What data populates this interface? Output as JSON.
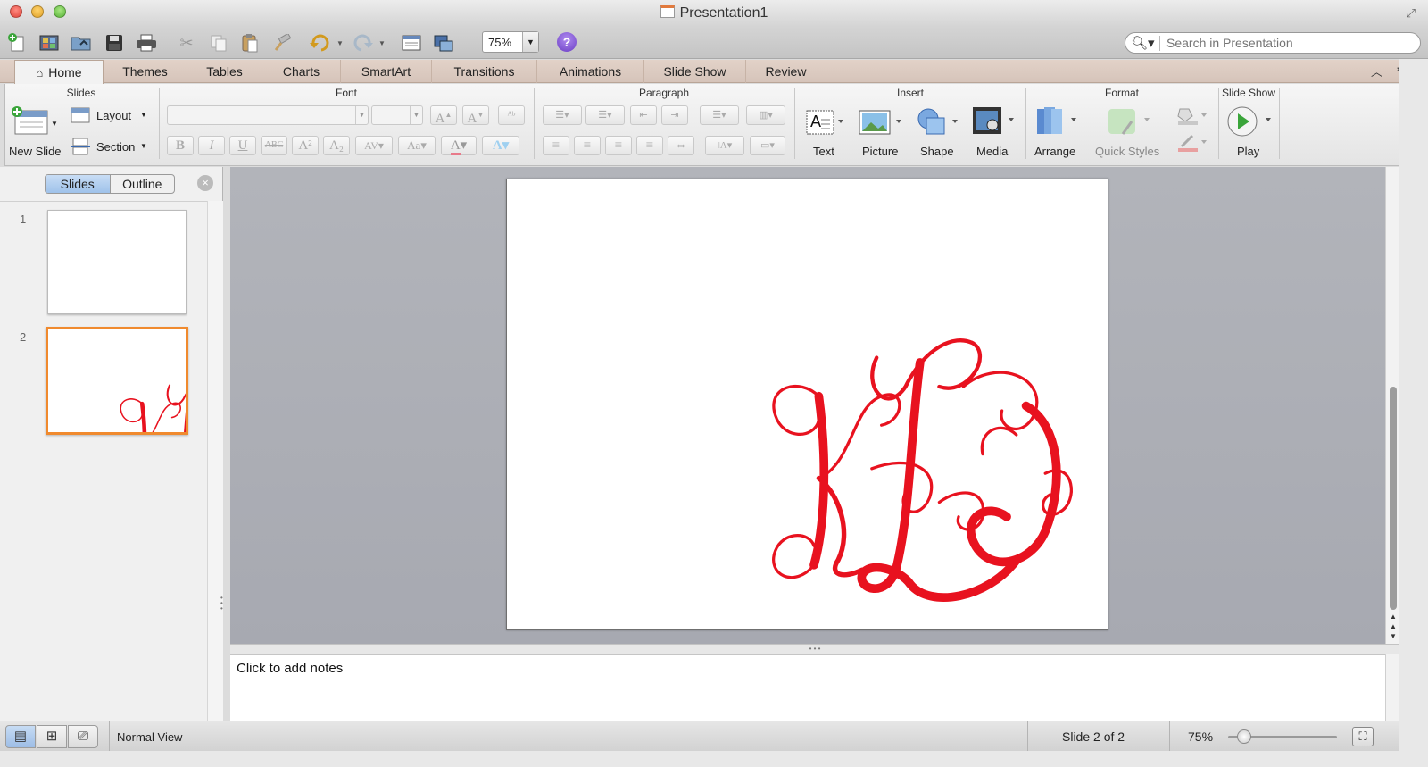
{
  "window": {
    "title": "Presentation1"
  },
  "toolbar": {
    "zoom_value": "75%",
    "help_label": "?",
    "search_placeholder": "Search in Presentation",
    "icons": [
      "new-document-icon",
      "gallery-icon",
      "open-icon",
      "save-icon",
      "print-icon",
      "cut-icon",
      "copy-icon",
      "paste-icon",
      "format-painter-icon",
      "undo-icon",
      "redo-icon",
      "slide-layout-icon",
      "media-browser-icon",
      "help-icon",
      "search-icon"
    ]
  },
  "tabs": [
    {
      "label": "Home",
      "active": true
    },
    {
      "label": "Themes"
    },
    {
      "label": "Tables"
    },
    {
      "label": "Charts"
    },
    {
      "label": "SmartArt"
    },
    {
      "label": "Transitions"
    },
    {
      "label": "Animations"
    },
    {
      "label": "Slide Show"
    },
    {
      "label": "Review"
    }
  ],
  "ribbon": {
    "groups": {
      "slides": "Slides",
      "font": "Font",
      "paragraph": "Paragraph",
      "insert": "Insert",
      "format": "Format",
      "slideshow": "Slide Show"
    },
    "new_slide": "New Slide",
    "layout": "Layout",
    "section": "Section",
    "text": "Text",
    "picture": "Picture",
    "shape": "Shape",
    "media": "Media",
    "arrange": "Arrange",
    "quick_styles": "Quick Styles",
    "play": "Play",
    "font_buttons": {
      "bold": "B",
      "italic": "I",
      "underline": "U",
      "strike": "ABC",
      "superscript": "A²",
      "subscript": "A₂"
    }
  },
  "left_panel": {
    "tab_slides": "Slides",
    "tab_outline": "Outline",
    "active_tab": "Slides",
    "slides": [
      {
        "number": "1",
        "selected": false
      },
      {
        "number": "2",
        "selected": true
      }
    ]
  },
  "slide": {
    "monogram_color": "#e8121f"
  },
  "notes": {
    "placeholder": "Click to add notes"
  },
  "statusbar": {
    "view_label": "Normal View",
    "slide_position": "Slide 2 of 2",
    "zoom": "75%",
    "zoom_fraction": 0.15
  },
  "colors": {
    "accent_selection": "#f08a2e",
    "tab_bar": "#dccabf",
    "monogram": "#e8121f"
  }
}
